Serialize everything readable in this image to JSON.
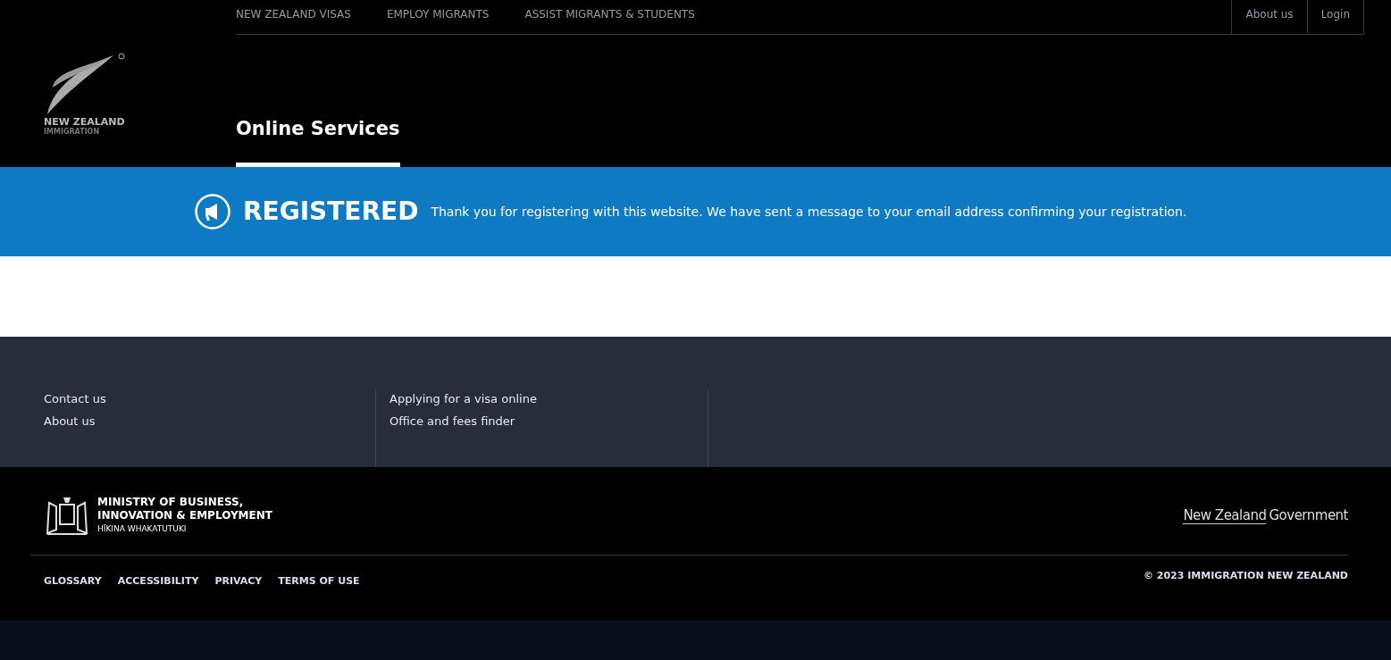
{
  "main_nav": [
    "NEW ZEALAND VISAS",
    "EMPLOY MIGRANTS",
    "ASSIST MIGRANTS & STUDENTS"
  ],
  "utility_nav": [
    "About us",
    "Login"
  ],
  "logo": {
    "line_1": "NEW ZEALAND",
    "line_2": "IMMIGRATION"
  },
  "tabs": [
    {
      "label": "Online Services",
      "selected": true
    }
  ],
  "banner": {
    "title": "REGISTERED",
    "message": "Thank you for registering with this website. We have sent a message to your email address confirming your registration."
  },
  "footer_columns": [
    [
      "Contact us",
      "About us"
    ],
    [
      "Applying for a visa online",
      "Office and fees finder"
    ]
  ],
  "ministry_logo": {
    "line_1": "MINISTRY OF BUSINESS,",
    "line_2": "INNOVATION & EMPLOYMENT",
    "line_3": "HĪKINA WHAKATUTUKI"
  },
  "government_logo": {
    "part_1": "New Zealand",
    "part_2": "Government"
  },
  "legal_links": [
    "GLOSSARY",
    "ACCESSIBILITY",
    "PRIVACY",
    "TERMS OF USE"
  ],
  "copyright": "© 2023 IMMIGRATION NEW ZEALAND"
}
